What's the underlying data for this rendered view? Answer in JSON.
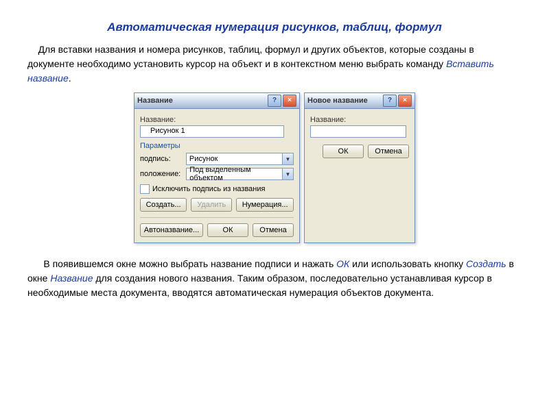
{
  "heading": "Автоматическая нумерация рисунков, таблиц, формул",
  "para1_a": "Для вставки названия и номера рисунков, таблиц, формул и других объектов, которые созданы в документе необходимо установить курсор на объект и в контекстном меню выбрать команду ",
  "para1_cmd": "Вставить название",
  "para1_period": ".",
  "para2_a": "В появившемся окне можно выбрать название подписи и нажать ",
  "para2_ok": "ОК",
  "para2_b": " или использовать кнопку ",
  "para2_create": "Создать",
  "para2_c": " в окне ",
  "para2_name": "Название",
  "para2_d": " для создания нового названия. Таким образом, последовательно устанавливая курсор в необходимые места документа, вводятся  автоматическая нумерация объектов документа.",
  "dlg1": {
    "title": "Название",
    "label_name": "Название:",
    "name_value": "Рисунок 1",
    "section": "Параметры",
    "label_caption": "подпись:",
    "caption_value": "Рисунок",
    "label_position": "положение:",
    "position_value": "Под выделенным объектом",
    "checkbox": "Исключить подпись из названия",
    "btn_create": "Создать...",
    "btn_delete": "Удалить",
    "btn_numbering": "Нумерация...",
    "btn_auto": "Автоназвание...",
    "btn_ok": "ОК",
    "btn_cancel": "Отмена"
  },
  "dlg2": {
    "title": "Новое название",
    "label_name": "Название:",
    "btn_ok": "ОК",
    "btn_cancel": "Отмена"
  }
}
